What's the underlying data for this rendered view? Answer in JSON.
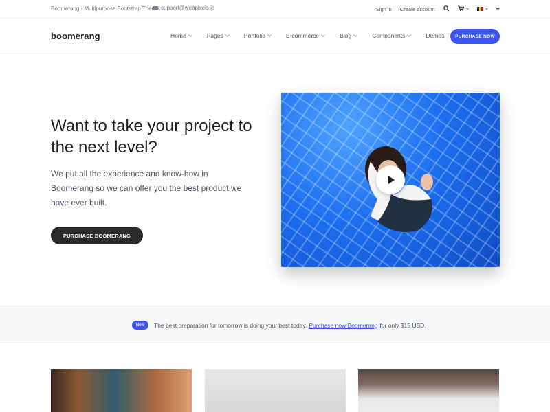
{
  "topbar": {
    "tagline": "Boomerang - Multipurpose Bootstrap Theme",
    "support_email": "support@webpixels.io",
    "sign_in": "Sign in",
    "create_account": "Create account",
    "menu_dots": "•••"
  },
  "nav": {
    "logo": "boomerang",
    "items": [
      {
        "label": "Home",
        "has_caret": true
      },
      {
        "label": "Pages",
        "has_caret": true
      },
      {
        "label": "Portfolio",
        "has_caret": true
      },
      {
        "label": "E-commerce",
        "has_caret": true
      },
      {
        "label": "Blog",
        "has_caret": true
      },
      {
        "label": "Components",
        "has_caret": true
      },
      {
        "label": "Demos",
        "has_caret": false
      }
    ],
    "purchase_button": "Purchase now"
  },
  "hero": {
    "title": "Want to take your project to the next level?",
    "text": "We put all the experience and know-how in Boomerang so we can offer you the best product we have ever built.",
    "button": "Purchase Boomerang"
  },
  "announcement": {
    "badge": "New",
    "text_before": "The best preparation for tomorrow is doing your best today.",
    "link": "Purchase now Boomerang",
    "text_after": "for only $15 USD."
  },
  "colors": {
    "accent": "#3b54f2",
    "dark_button": "#2a2a2a"
  }
}
